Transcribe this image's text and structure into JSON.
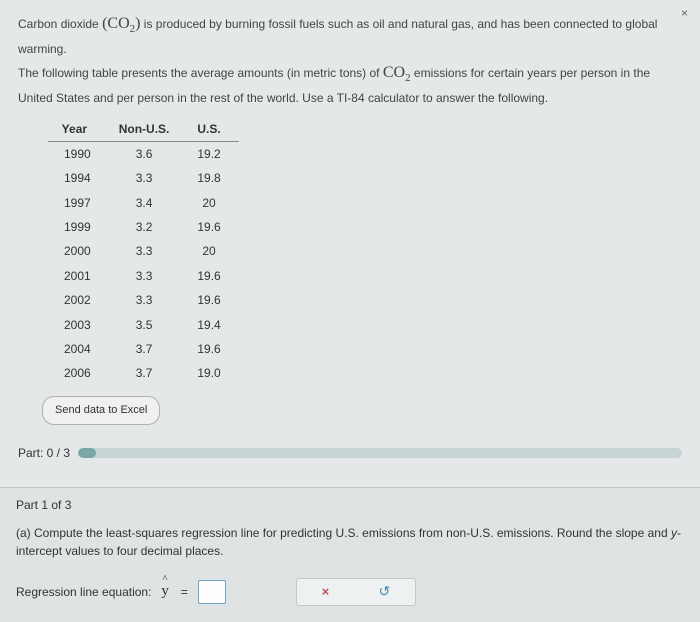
{
  "corner_mark": "×",
  "intro": {
    "p1a": "Carbon dioxide ",
    "formula_open": "(",
    "formula_body": "CO",
    "formula_sub": "2",
    "formula_close": ")",
    "p1b": " is produced by burning fossil fuels such as oil and natural gas, and has been connected to global warming.",
    "p2a": "The following table presents the average amounts (in metric tons) of ",
    "p2_formula_body": "CO",
    "p2_formula_sub": "2",
    "p2b": " emissions for certain years per person in the United States and per person in the rest of the world. Use a TI-84 calculator to answer the following."
  },
  "table": {
    "headers": {
      "year": "Year",
      "nonus": "Non-U.S.",
      "us": "U.S."
    },
    "rows": [
      {
        "year": "1990",
        "nonus": "3.6",
        "us": "19.2"
      },
      {
        "year": "1994",
        "nonus": "3.3",
        "us": "19.8"
      },
      {
        "year": "1997",
        "nonus": "3.4",
        "us": "20"
      },
      {
        "year": "1999",
        "nonus": "3.2",
        "us": "19.6"
      },
      {
        "year": "2000",
        "nonus": "3.3",
        "us": "20"
      },
      {
        "year": "2001",
        "nonus": "3.3",
        "us": "19.6"
      },
      {
        "year": "2002",
        "nonus": "3.3",
        "us": "19.6"
      },
      {
        "year": "2003",
        "nonus": "3.5",
        "us": "19.4"
      },
      {
        "year": "2004",
        "nonus": "3.7",
        "us": "19.6"
      },
      {
        "year": "2006",
        "nonus": "3.7",
        "us": "19.0"
      }
    ]
  },
  "buttons": {
    "send_excel": "Send data to Excel"
  },
  "progress": {
    "label": "Part: 0 / 3"
  },
  "part1": {
    "title": "Part 1 of 3",
    "q_a": "(a) Compute the least-squares regression line for predicting U.S. emissions from non-U.S. emissions. Round the slope and ",
    "q_ital": "y",
    "q_b": "-intercept values to four decimal places.",
    "eq_label": "Regression line equation: ",
    "yhat": "y",
    "equals": "=",
    "clear": "×",
    "reset": "↺"
  }
}
